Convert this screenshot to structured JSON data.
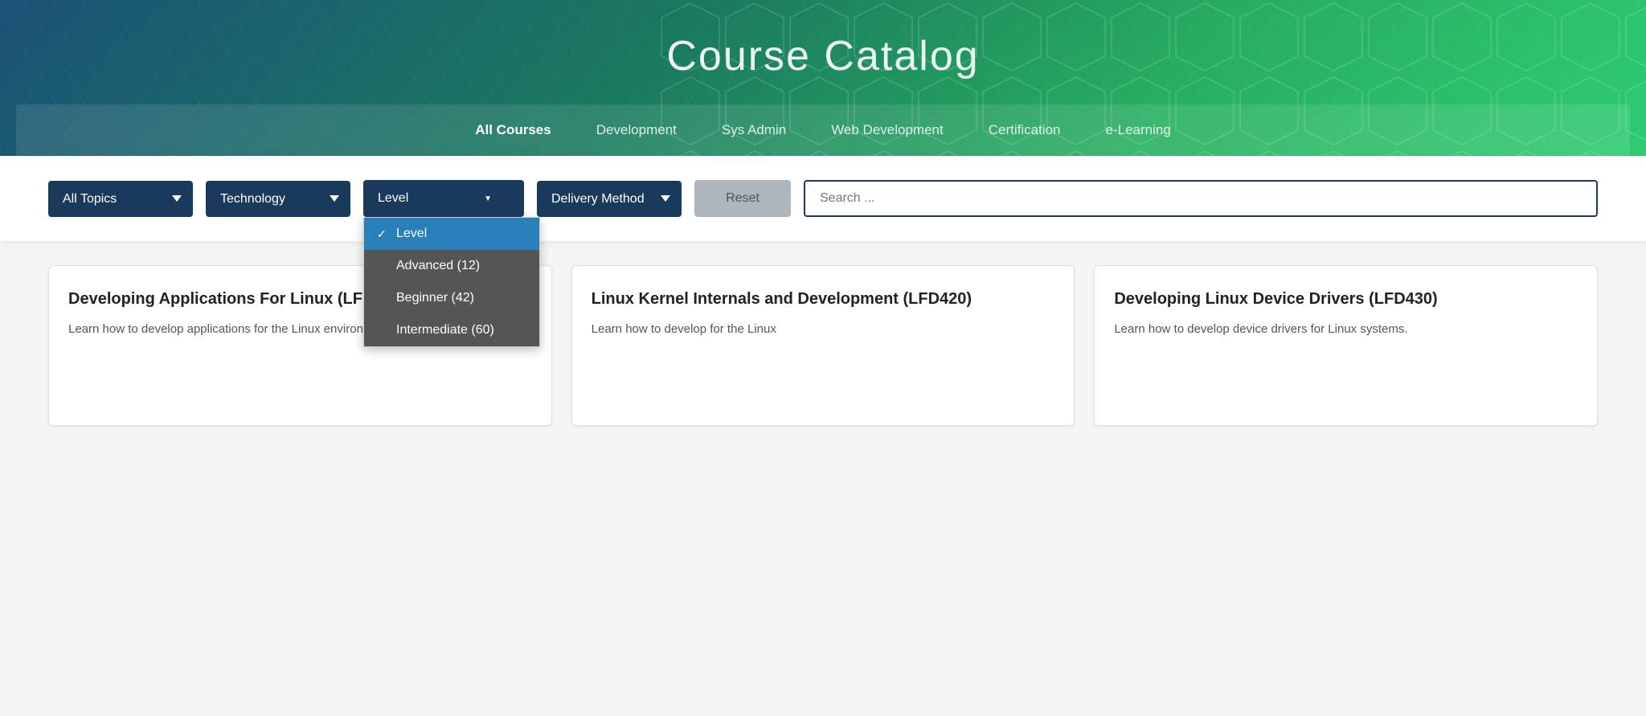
{
  "hero": {
    "title": "Course Catalog",
    "nav": [
      {
        "label": "All Courses",
        "active": true
      },
      {
        "label": "Development",
        "active": false
      },
      {
        "label": "Sys Admin",
        "active": false
      },
      {
        "label": "Web Development",
        "active": false
      },
      {
        "label": "Certification",
        "active": false
      },
      {
        "label": "e-Learning",
        "active": false
      }
    ]
  },
  "filters": {
    "topics_label": "All Topics",
    "technology_label": "Technology",
    "level_label": "Level",
    "delivery_label": "Delivery Method",
    "reset_label": "Reset",
    "search_placeholder": "Search ...",
    "level_options": [
      {
        "label": "Level",
        "selected": true
      },
      {
        "label": "Advanced  (12)",
        "selected": false
      },
      {
        "label": "Beginner  (42)",
        "selected": false
      },
      {
        "label": "Intermediate  (60)",
        "selected": false
      }
    ]
  },
  "courses": [
    {
      "title": "Developing Applications For Linux (LFD401)",
      "description": "Learn how to develop applications for the Linux environment."
    },
    {
      "title": "Linux Kernel Internals and Development (LFD420)",
      "description": "Learn how to develop for the Linux"
    },
    {
      "title": "Developing Linux Device Drivers (LFD430)",
      "description": "Learn how to develop device drivers for Linux systems."
    }
  ]
}
